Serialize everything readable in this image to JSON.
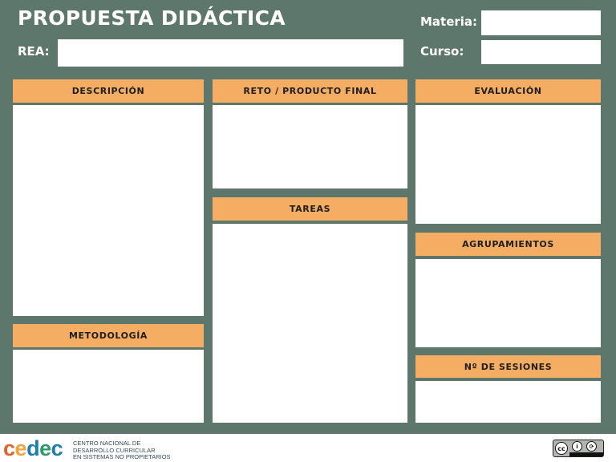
{
  "header": {
    "title": "PROPUESTA DIDÁCTICA",
    "rea_label": "REA:",
    "rea_value": "",
    "materia_label": "Materia:",
    "materia_value": "",
    "curso_label": "Curso:",
    "curso_value": ""
  },
  "sections": {
    "descripcion": "DESCRIPCIÓN",
    "reto": "RETO / PRODUCTO FINAL",
    "evaluacion": "EVALUACIÓN",
    "tareas": "TAREAS",
    "agrupamientos": "AGRUPAMIENTOS",
    "metodologia": "METODOLOGÍA",
    "sesiones": "Nº DE SESIONES"
  },
  "footer": {
    "logo_letters": [
      "c",
      "e",
      "d",
      "e",
      "c"
    ],
    "logo_colors": [
      "#e0632b",
      "#f2a33a",
      "#1f7ea8",
      "#2e9a68",
      "#1f7ea8"
    ],
    "logo_subtitle_lines": [
      "CENTRO NACIONAL DE",
      "DESARROLLO CURRICULAR",
      "EN SISTEMAS NO PROPIETARIOS"
    ],
    "license_icon": "cc-by-sa-icon"
  },
  "colors": {
    "background": "#5e776d",
    "section_header": "#f4ad62"
  }
}
